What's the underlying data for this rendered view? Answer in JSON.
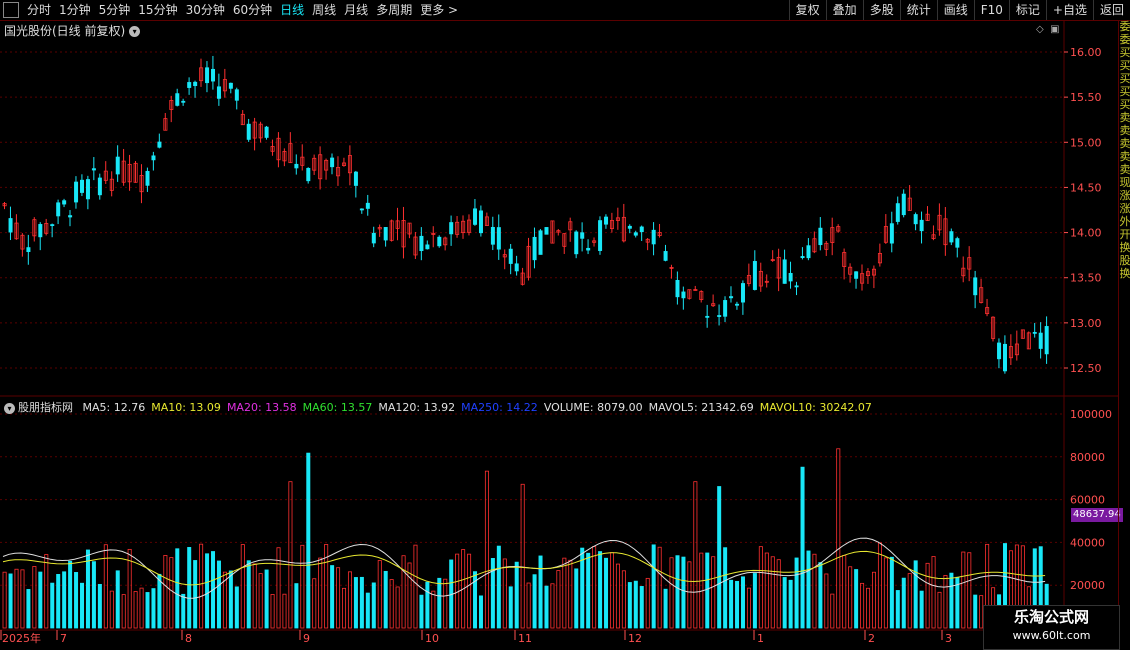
{
  "toolbar": {
    "periods": [
      "分时",
      "1分钟",
      "5分钟",
      "15分钟",
      "30分钟",
      "60分钟",
      "日线",
      "周线",
      "月线",
      "多周期",
      "更多 >"
    ],
    "active_period": "日线",
    "tools": [
      "复权",
      "叠加",
      "多股",
      "统计",
      "画线",
      "F10",
      "标记",
      "+自选",
      "返回"
    ]
  },
  "stock": {
    "title": "国光股份(日线 前复权)"
  },
  "indicator": {
    "name": "股朋指标网",
    "items": [
      {
        "label": "MA5: 12.76",
        "color": "#e0e0e0"
      },
      {
        "label": "MA10: 13.09",
        "color": "#e8e830"
      },
      {
        "label": "MA20: 13.58",
        "color": "#e030e0"
      },
      {
        "label": "MA60: 13.57",
        "color": "#30e030"
      },
      {
        "label": "MA120: 13.92",
        "color": "#e0e0e0"
      },
      {
        "label": "MA250: 14.22",
        "color": "#2040ff"
      },
      {
        "label": "VOLUME: 8079.00",
        "color": "#e0e0e0"
      },
      {
        "label": "MAVOL5: 21342.69",
        "color": "#e0e0e0"
      },
      {
        "label": "MAVOL10: 30242.07",
        "color": "#e8e830"
      }
    ]
  },
  "price_axis": [
    "16.00",
    "15.50",
    "15.00",
    "14.50",
    "14.00",
    "13.50",
    "13.00",
    "12.50"
  ],
  "volume_axis": [
    "100000",
    "80000",
    "60000",
    "40000",
    "20000"
  ],
  "current_volume_label": "48637.94",
  "time_axis": [
    "2025年",
    "7",
    "8",
    "9",
    "10",
    "11",
    "12",
    "1",
    "2",
    "3"
  ],
  "watermark": {
    "title": "乐淘公式网",
    "url": "www.60lt.com"
  },
  "side_strip_chars": [
    "委",
    "委",
    "买",
    "买",
    "买",
    "买",
    "买",
    "卖",
    "卖",
    "卖",
    "卖",
    "卖",
    "现",
    "涨",
    "涨",
    "外",
    "开",
    "换",
    "股",
    "换"
  ],
  "colors": {
    "up": "#ff3030",
    "down": "#19e7f7",
    "grid": "#5a0000",
    "axis_text": "#ff5050"
  }
}
